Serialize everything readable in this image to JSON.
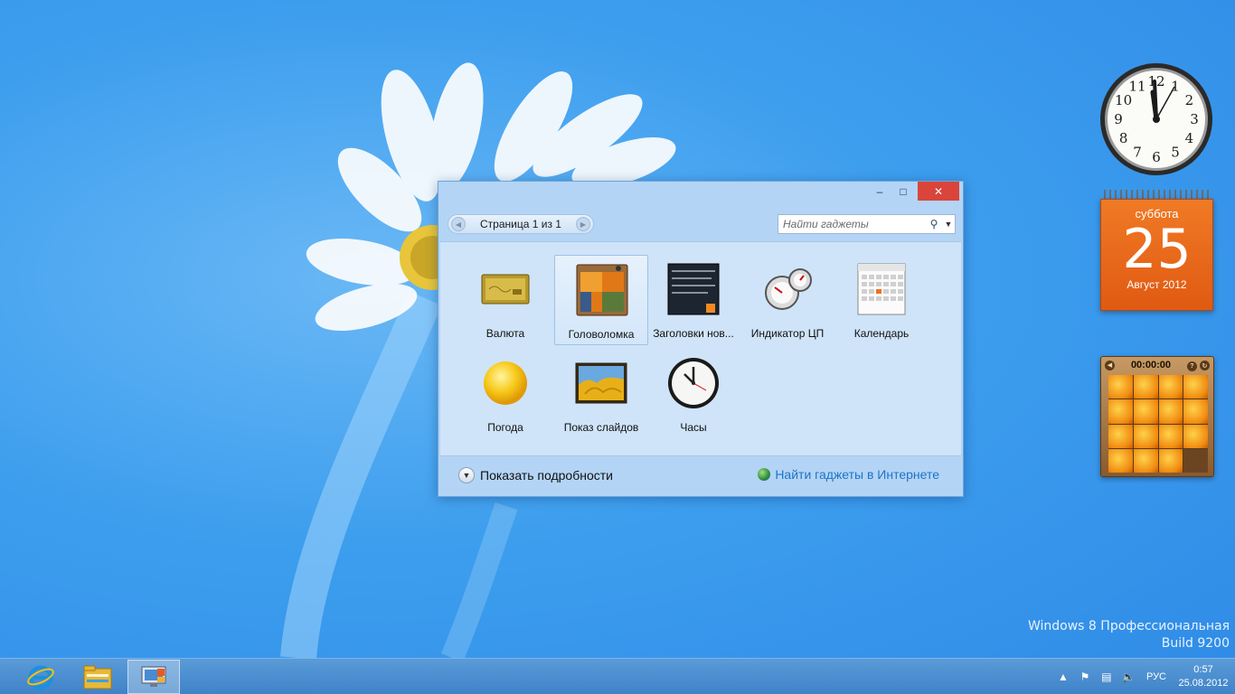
{
  "desktop": {
    "watermark_line1": "Windows 8 Профессиональная",
    "watermark_line2": "Build 9200"
  },
  "gallery": {
    "window_controls": {
      "minimize_icon": "minimize-icon",
      "maximize_icon": "maximize-icon",
      "close_icon": "close-icon"
    },
    "pager_label": "Страница 1 из 1",
    "search_placeholder": "Найти гаджеты",
    "gadgets": [
      {
        "label": "Валюта",
        "icon": "currency-icon",
        "selected": false
      },
      {
        "label": "Головоломка",
        "icon": "puzzle-icon",
        "selected": true
      },
      {
        "label": "Заголовки нов...",
        "icon": "news-feed-icon",
        "selected": false
      },
      {
        "label": "Индикатор ЦП",
        "icon": "cpu-meter-icon",
        "selected": false
      },
      {
        "label": "Календарь",
        "icon": "calendar-icon",
        "selected": false
      },
      {
        "label": "Погода",
        "icon": "weather-sun-icon",
        "selected": false
      },
      {
        "label": "Показ слайдов",
        "icon": "slideshow-icon",
        "selected": false
      },
      {
        "label": "Часы",
        "icon": "clock-icon",
        "selected": false
      }
    ],
    "show_details_label": "Показать подробности",
    "online_link_label": "Найти гаджеты в Интернете"
  },
  "gadgets_desktop": {
    "clock": {
      "hour_numerals": [
        "12",
        "1",
        "2",
        "3",
        "4",
        "5",
        "6",
        "7",
        "8",
        "9",
        "10",
        "11"
      ]
    },
    "calendar": {
      "weekday": "суббота",
      "day": "25",
      "month_year": "Август 2012",
      "accent": "#e8661a"
    },
    "puzzle": {
      "timer": "00:00:00"
    }
  },
  "taskbar": {
    "pinned": [
      {
        "name": "internet-explorer-icon"
      },
      {
        "name": "file-explorer-icon"
      },
      {
        "name": "desktop-gadgets-icon",
        "active": true
      }
    ],
    "tray": {
      "language": "РУС",
      "time": "0:57",
      "date": "25.08.2012"
    }
  }
}
